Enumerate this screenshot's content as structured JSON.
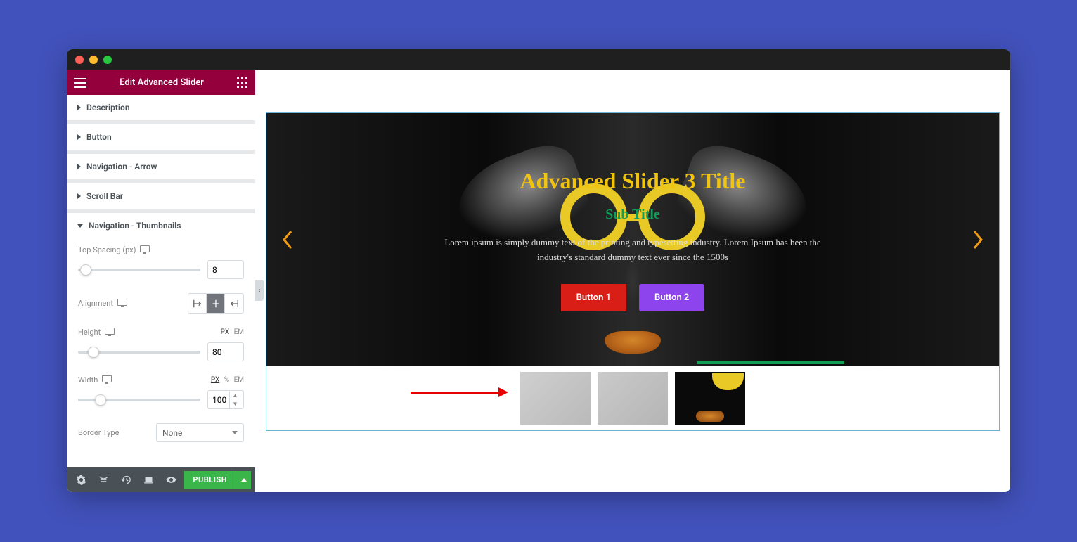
{
  "window": {
    "title": "Edit Advanced Slider"
  },
  "sections": {
    "description": "Description",
    "button": "Button",
    "nav_arrow": "Navigation - Arrow",
    "scroll_bar": "Scroll Bar",
    "nav_thumbs": "Navigation - Thumbnails"
  },
  "controls": {
    "top_spacing": {
      "label": "Top Spacing (px)",
      "value": "8"
    },
    "alignment": {
      "label": "Alignment"
    },
    "height": {
      "label": "Height",
      "value": "80",
      "units": {
        "px": "PX",
        "em": "EM"
      }
    },
    "width": {
      "label": "Width",
      "value": "100",
      "units": {
        "px": "PX",
        "pct": "%",
        "em": "EM"
      }
    },
    "border_type": {
      "label": "Border Type",
      "value": "None"
    }
  },
  "footer": {
    "publish": "PUBLISH"
  },
  "slide": {
    "title": "Advanced Slider 3 Title",
    "subtitle": "Sub Title",
    "desc": "Lorem ipsum is simply dummy text of the printing and typesetting industry. Lorem Ipsum has been the industry's standard dummy text ever since the 1500s",
    "btn1": "Button 1",
    "btn2": "Button 2"
  }
}
